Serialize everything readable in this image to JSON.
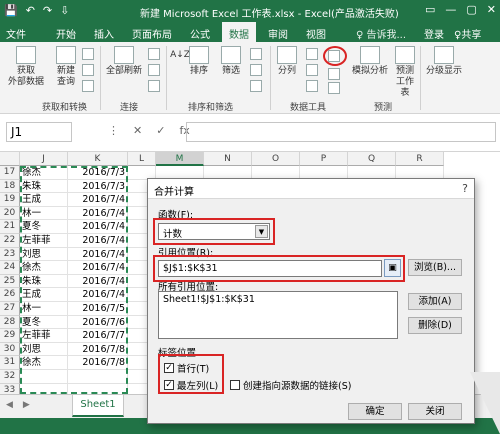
{
  "titlebar": {
    "title": "新建 Microsoft Excel 工作表.xlsx - Excel(产品激活失败)",
    "qat": [
      "💾",
      "↶",
      "↷",
      "⇩"
    ],
    "winbtns": [
      "▭",
      "—",
      "▢",
      "✕"
    ]
  },
  "tabs": {
    "items": [
      "文件",
      "开始",
      "插入",
      "页面布局",
      "公式",
      "数据",
      "审阅",
      "视图"
    ],
    "active": "数据",
    "tell": "♀ 告诉我...",
    "login": "登录",
    "share": "♀共享"
  },
  "ribbon": {
    "groups": [
      "获取和转换",
      "连接",
      "排序和筛选",
      "数据工具",
      "预测"
    ],
    "buttons": {
      "get_external": "获取\n外部数据",
      "new_query": "新建\n查询",
      "refresh_all": "全部刷新",
      "sort_az": "A↓Z",
      "sort": "排序",
      "filter": "筛选",
      "split": "分列",
      "whatif": "模拟分析",
      "forecast": "预测\n工作表",
      "outline": "分级显示"
    }
  },
  "formula_bar": {
    "namebox": "J1",
    "fx_icons": [
      "⋮",
      "✕",
      "✓",
      "fx"
    ],
    "value": ""
  },
  "grid": {
    "columns": [
      "J",
      "K",
      "L",
      "M",
      "N",
      "O",
      "P",
      "Q",
      "R"
    ],
    "selected_col": "M",
    "row_numbers": [
      "17",
      "18",
      "19",
      "20",
      "21",
      "22",
      "23",
      "24",
      "25",
      "26",
      "27",
      "28",
      "29",
      "30",
      "31",
      "32",
      "33"
    ],
    "names": [
      "徐杰",
      "朱珠",
      "王成",
      "林一",
      "夏冬",
      "左菲菲",
      "刘思",
      "徐杰",
      "朱珠",
      "王成",
      "林一",
      "夏冬",
      "左菲菲",
      "刘思",
      "徐杰",
      "",
      ""
    ],
    "dates": [
      "2016/7/3",
      "2016/7/3",
      "2016/7/4",
      "2016/7/4",
      "2016/7/4",
      "2016/7/4",
      "2016/7/4",
      "2016/7/4",
      "2016/7/4",
      "2016/7/4",
      "2016/7/5",
      "2016/7/6",
      "2016/7/7",
      "2016/7/8",
      "2016/7/8",
      "",
      ""
    ]
  },
  "sheets": {
    "nav": [
      "◀",
      "▶"
    ],
    "active": "Sheet1"
  },
  "dialog": {
    "title": "合并计算",
    "close": "?",
    "function_label": "函数(F):",
    "function_value": "计数",
    "ref_label": "引用位置(R):",
    "ref_value": "$J$1:$K$31",
    "browse": "浏览(B)...",
    "all_refs_label": "所有引用位置:",
    "all_refs": [
      "Sheet1!$J$1:$K$31"
    ],
    "add": "添加(A)",
    "delete": "删除(D)",
    "label_pos": "标签位置",
    "top_row": "首行(T)",
    "left_col": "最左列(L)",
    "link_source": "创建指向源数据的链接(S)",
    "ok": "确定",
    "cancel": "关闭"
  }
}
